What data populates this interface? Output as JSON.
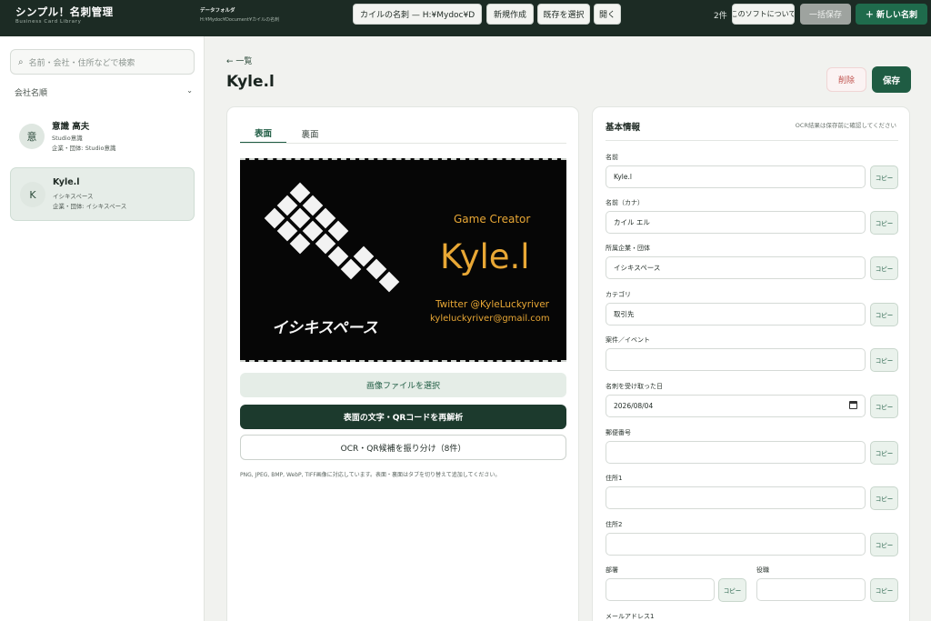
{
  "app": {
    "title": "シンプル！名刺管理",
    "subtitle": "Business Card Library"
  },
  "toolbar": {
    "data_folder_label": "データフォルダ",
    "data_folder_path": "H:¥Mydoc¥Document¥カイルの名刺",
    "library_select": "カイルの名刺 — H:¥Mydoc¥D",
    "new_label": "新規作成",
    "select_existing_label": "既存を選択",
    "open_label": "開く",
    "count": "2件",
    "about_label": "このソフトについて",
    "bulk_save_label": "一括保存",
    "new_card_label": "＋ 新しい名刺"
  },
  "sidebar": {
    "search_placeholder": "名前・会社・住所などで検索",
    "sort_label": "会社名順",
    "cards": [
      {
        "avatar": "意",
        "name": "意識 高夫",
        "company": "Studio意識",
        "group": "企業・団体: Studio意識"
      },
      {
        "avatar": "K",
        "name": "Kyle.l",
        "company": "イシキスペース",
        "group": "企業・団体: イシキスペース"
      }
    ]
  },
  "main": {
    "back_label": "← 一覧",
    "title": "Kyle.l",
    "delete_label": "削除",
    "save_label": "保存"
  },
  "image_panel": {
    "tabs": [
      "表面",
      "裏面"
    ],
    "card_image": {
      "role": "Game Creator",
      "name": "Kyle.l",
      "twitter": "Twitter @KyleLuckyriver",
      "email": "kyleluckyriver@gmail.com",
      "logo_text": "イシキスペース"
    },
    "select_file_label": "画像ファイルを選択",
    "reanalyze_label": "表面の文字・QRコードを再解析",
    "assign_label": "OCR・QR候補を振り分け（8件）",
    "hint": "PNG, JPEG, BMP, WebP, TIFF画像に対応しています。表面・裏面はタブを切り替えて追加してください。"
  },
  "form": {
    "title": "基本情報",
    "note": "OCR結果は保存前に確認してください",
    "copy_label": "コピー",
    "fields": [
      {
        "label": "名前",
        "value": "Kyle.l"
      },
      {
        "label": "名前（カナ）",
        "value": "カイル エル"
      },
      {
        "label": "所属企業・団体",
        "value": "イシキスペース"
      },
      {
        "label": "カテゴリ",
        "value": "取引先"
      },
      {
        "label": "案件／イベント",
        "value": ""
      },
      {
        "label": "名刺を受け取った日",
        "value": "2026/08/04"
      },
      {
        "label": "郵便番号",
        "value": ""
      },
      {
        "label": "住所1",
        "value": ""
      },
      {
        "label": "住所2",
        "value": ""
      }
    ],
    "dept_label": "部署",
    "dept_value": "",
    "position_label": "役職",
    "position_value": "",
    "email1_label": "メールアドレス1"
  }
}
